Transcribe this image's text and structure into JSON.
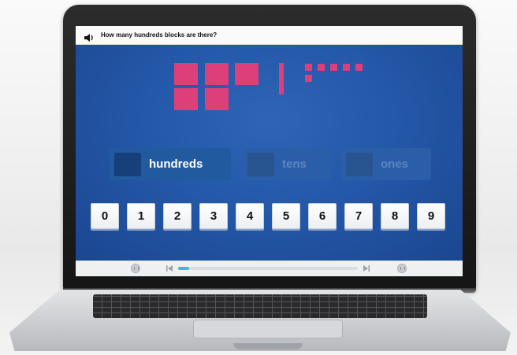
{
  "question": {
    "text": "How many hundreds blocks are there?",
    "audio_icon": "speaker-icon"
  },
  "blocks": {
    "hundreds_count": 5,
    "tens_count": 1,
    "ones_count": 6
  },
  "place_values": [
    {
      "label": "hundreds",
      "state": "active"
    },
    {
      "label": "tens",
      "state": "inactive"
    },
    {
      "label": "ones",
      "state": "inactive"
    }
  ],
  "keypad": [
    "0",
    "1",
    "2",
    "3",
    "4",
    "5",
    "6",
    "7",
    "8",
    "9"
  ],
  "controls": {
    "left_button_icon": "pause-icon",
    "back_icon": "skip-back-icon",
    "forward_icon": "skip-forward-icon",
    "right_button_icon": "pause-icon",
    "progress": 0.06
  },
  "colors": {
    "block": "#dc3f79",
    "stage": "#2458a9",
    "progress": "#3cb7ea"
  }
}
